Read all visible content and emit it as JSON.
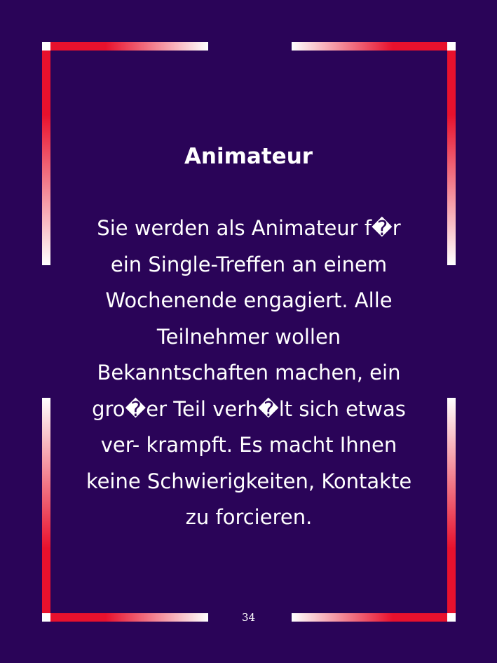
{
  "card": {
    "title": "Animateur",
    "body_lines": [
      "Sie werden als Animateur f�r",
      "ein Single-Treffen an einem",
      "Wochenende engagiert. Alle",
      "Teilnehmer wollen",
      "Bekanntschaften machen, ein",
      "gro�er Teil verh�lt sich etwas",
      "ver- krampft. Es macht Ihnen",
      "keine Schwierigkeiten, Kontakte",
      "zu forcieren."
    ],
    "page_number": "34"
  },
  "colors": {
    "background": "#2a0458",
    "frame_red": "#e8112d",
    "frame_white": "#ffffff",
    "text": "#ffffff"
  }
}
